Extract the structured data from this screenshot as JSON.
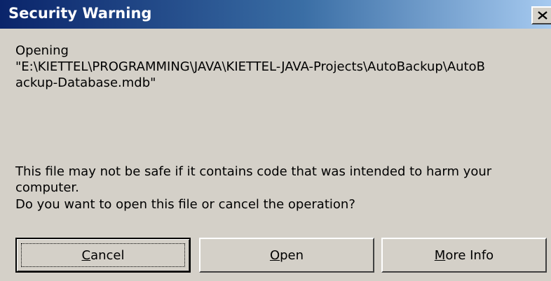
{
  "window": {
    "title": "Security Warning"
  },
  "message": {
    "line1": "Opening",
    "line2": "\"E:\\KIETTEL\\PROGRAMMING\\JAVA\\KIETTEL-JAVA-Projects\\AutoBackup\\AutoB",
    "line3": "ackup-Database.mdb\"",
    "warning_line1": "This file may not be safe if it contains code that was intended to harm your",
    "warning_line2": "computer.",
    "question": "Do you want to open this file or cancel the operation?"
  },
  "buttons": {
    "cancel": {
      "accel": "C",
      "rest": "ancel"
    },
    "open": {
      "accel": "O",
      "rest": "pen"
    },
    "more_info": {
      "accel": "M",
      "rest": "ore Info"
    }
  },
  "icons": {
    "close": "close-icon"
  },
  "colors": {
    "face": "#d4d0c8",
    "title_start": "#0a246a",
    "title_end": "#a6caf0"
  }
}
